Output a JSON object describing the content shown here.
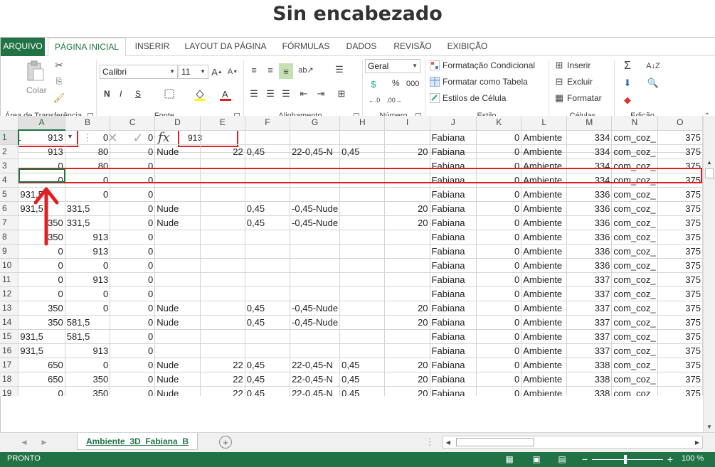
{
  "page_title": "Sin encabezado",
  "tabs": [
    "ARQUIVO",
    "PÁGINA INICIAL",
    "INSERIR",
    "LAYOUT DA PÁGINA",
    "FÓRMULAS",
    "DADOS",
    "REVISÃO",
    "EXIBIÇÃO"
  ],
  "ribbon": {
    "clipboard": {
      "paste": "Colar",
      "label": "Área de Transferência"
    },
    "font": {
      "name": "Calibri",
      "size": "11",
      "bold": "N",
      "italic": "I",
      "underline": "S",
      "label": "Fonte"
    },
    "alignment": {
      "label": "Alinhamento"
    },
    "number": {
      "format": "Geral",
      "percent": "%",
      "thousands": "000",
      "label": "Número"
    },
    "styles": {
      "conditional": "Formatação Condicional",
      "as_table": "Formatar como Tabela",
      "cell_styles": "Estilos de Célula",
      "label": "Estilo"
    },
    "cells": {
      "insert": "Inserir",
      "delete": "Excluir",
      "format": "Formatar",
      "label": "Células"
    },
    "editing": {
      "label": "Edição"
    }
  },
  "formula_bar": {
    "name_box": "A1",
    "fx": "fx",
    "value": "913"
  },
  "columns": [
    "A",
    "B",
    "C",
    "D",
    "E",
    "F",
    "G",
    "H",
    "I",
    "J",
    "K",
    "L",
    "M",
    "N",
    "O"
  ],
  "rows": [
    [
      "1",
      "913",
      "0",
      "0",
      "",
      "",
      "",
      "",
      "",
      "",
      "Fabiana",
      "0",
      "Ambiente",
      "334",
      "com_coz_",
      "375"
    ],
    [
      "2",
      "913",
      "80",
      "0",
      "Nude",
      "22",
      "0,45",
      "22-0,45-N",
      "0,45",
      "20",
      "Fabiana",
      "0",
      "Ambiente",
      "334",
      "com_coz_",
      "375"
    ],
    [
      "3",
      "0",
      "80",
      "0",
      "",
      "",
      "",
      "",
      "",
      "",
      "Fabiana",
      "0",
      "Ambiente",
      "334",
      "com_coz_",
      "375"
    ],
    [
      "4",
      "0",
      "0",
      "0",
      "",
      "",
      "",
      "",
      "",
      "",
      "Fabiana",
      "0",
      "Ambiente",
      "334",
      "com_coz_",
      "375"
    ],
    [
      "5",
      "931,5",
      "0",
      "0",
      "",
      "",
      "",
      "",
      "",
      "",
      "Fabiana",
      "0",
      "Ambiente",
      "336",
      "com_coz_",
      "375"
    ],
    [
      "6",
      "931,5",
      "331,5",
      "0",
      "Nude",
      "",
      "0,45",
      "-0,45-Nude",
      "",
      "20",
      "Fabiana",
      "0",
      "Ambiente",
      "336",
      "com_coz_",
      "375"
    ],
    [
      "7",
      "350",
      "331,5",
      "0",
      "Nude",
      "",
      "0,45",
      "-0,45-Nude",
      "",
      "20",
      "Fabiana",
      "0",
      "Ambiente",
      "336",
      "com_coz_",
      "375"
    ],
    [
      "8",
      "350",
      "913",
      "0",
      "",
      "",
      "",
      "",
      "",
      "",
      "Fabiana",
      "0",
      "Ambiente",
      "336",
      "com_coz_",
      "375"
    ],
    [
      "9",
      "0",
      "913",
      "0",
      "",
      "",
      "",
      "",
      "",
      "",
      "Fabiana",
      "0",
      "Ambiente",
      "336",
      "com_coz_",
      "375"
    ],
    [
      "10",
      "0",
      "0",
      "0",
      "",
      "",
      "",
      "",
      "",
      "",
      "Fabiana",
      "0",
      "Ambiente",
      "336",
      "com_coz_",
      "375"
    ],
    [
      "11",
      "0",
      "913",
      "0",
      "",
      "",
      "",
      "",
      "",
      "",
      "Fabiana",
      "0",
      "Ambiente",
      "337",
      "com_coz_",
      "375"
    ],
    [
      "12",
      "0",
      "0",
      "0",
      "",
      "",
      "",
      "",
      "",
      "",
      "Fabiana",
      "0",
      "Ambiente",
      "337",
      "com_coz_",
      "375"
    ],
    [
      "13",
      "350",
      "0",
      "0",
      "Nude",
      "",
      "0,45",
      "-0,45-Nude",
      "",
      "20",
      "Fabiana",
      "0",
      "Ambiente",
      "337",
      "com_coz_",
      "375"
    ],
    [
      "14",
      "350",
      "581,5",
      "0",
      "Nude",
      "",
      "0,45",
      "-0,45-Nude",
      "",
      "20",
      "Fabiana",
      "0",
      "Ambiente",
      "337",
      "com_coz_",
      "375"
    ],
    [
      "15",
      "931,5",
      "581,5",
      "0",
      "",
      "",
      "",
      "",
      "",
      "",
      "Fabiana",
      "0",
      "Ambiente",
      "337",
      "com_coz_",
      "375"
    ],
    [
      "16",
      "931,5",
      "913",
      "0",
      "",
      "",
      "",
      "",
      "",
      "",
      "Fabiana",
      "0",
      "Ambiente",
      "337",
      "com_coz_",
      "375"
    ],
    [
      "17",
      "650",
      "0",
      "0",
      "Nude",
      "22",
      "0,45",
      "22-0,45-N",
      "0,45",
      "20",
      "Fabiana",
      "0",
      "Ambiente",
      "338",
      "com_coz_",
      "375"
    ],
    [
      "18",
      "650",
      "350",
      "0",
      "Nude",
      "22",
      "0,45",
      "22-0,45-N",
      "0,45",
      "20",
      "Fabiana",
      "0",
      "Ambiente",
      "338",
      "com_coz_",
      "375"
    ],
    [
      "19",
      "0",
      "350",
      "0",
      "Nude",
      "22",
      "0,45",
      "22-0,45-N",
      "0,45",
      "20",
      "Fabiana",
      "0",
      "Ambiente",
      "338",
      "com_coz_",
      "375"
    ]
  ],
  "sheet_tab": "Ambiente_3D_Fabiana_B",
  "status": {
    "ready": "PRONTO",
    "zoom": "100 %"
  },
  "colors": {
    "excel_green": "#217346",
    "annotation_red": "#e02020"
  }
}
